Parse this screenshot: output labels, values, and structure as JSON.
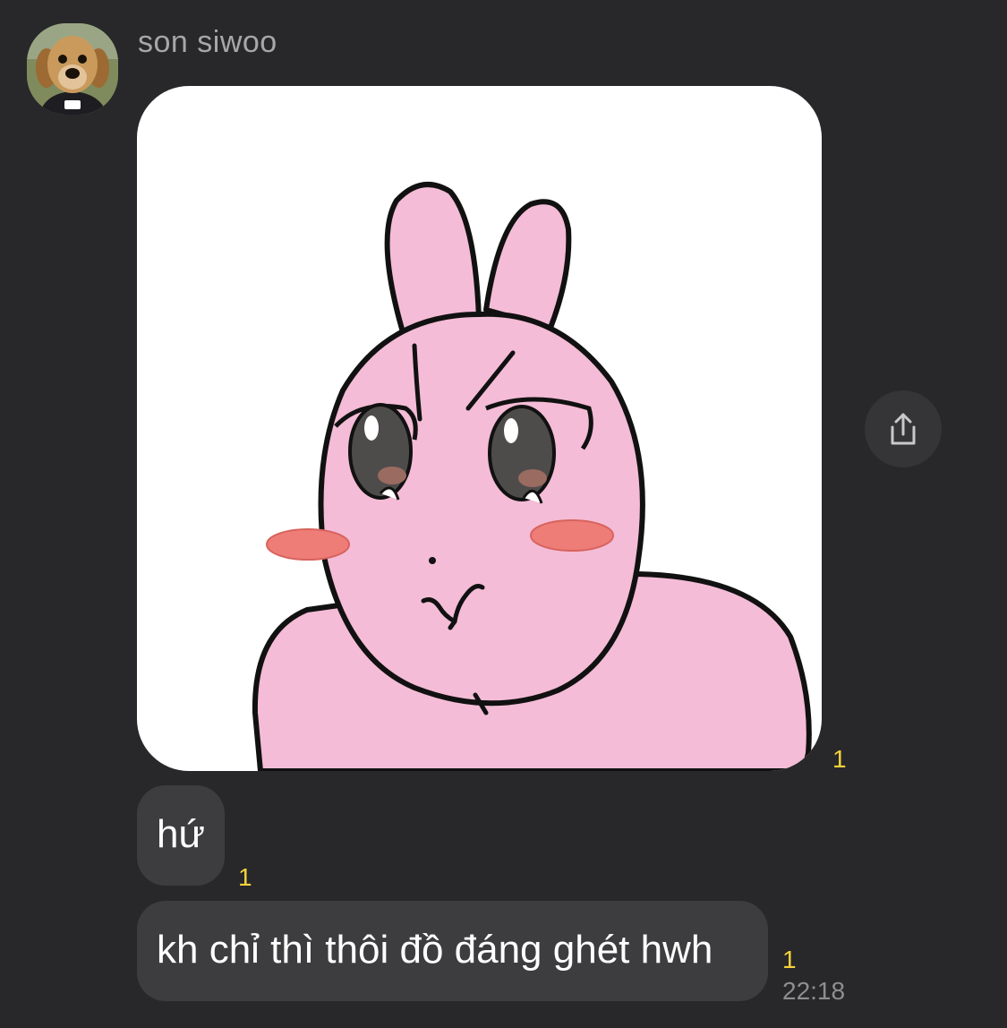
{
  "chat": {
    "sender_name": "son siwoo",
    "avatar_icon": "puppy-avatar",
    "share_icon": "share-icon",
    "unread_color": "#f4d23b",
    "messages": [
      {
        "type": "sticker",
        "sticker": "pink-bunny-pouting",
        "unread": "1"
      },
      {
        "type": "text",
        "text": "hứ",
        "unread": "1"
      },
      {
        "type": "text",
        "text": "kh chỉ thì thôi đồ đáng ghét hwh",
        "unread": "1",
        "time": "22:18"
      }
    ]
  }
}
